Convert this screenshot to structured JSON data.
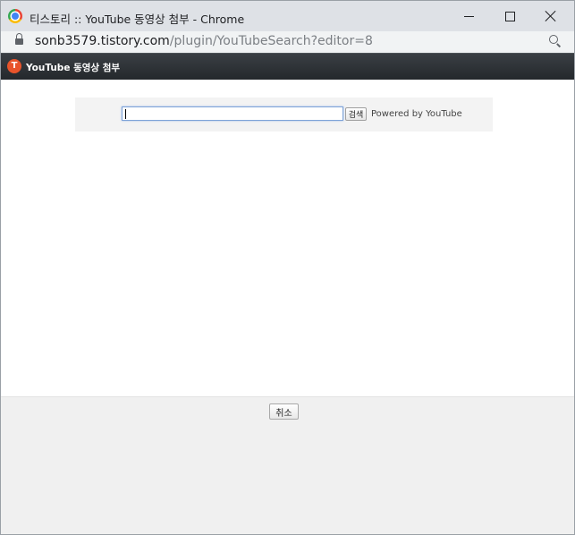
{
  "window": {
    "title": "티스토리 :: YouTube 동영상 첨부 - Chrome"
  },
  "address": {
    "host": "sonb3579.tistory.com",
    "path": "/plugin/YouTubeSearch?editor=8"
  },
  "plugin": {
    "logo_glyph": "T",
    "title": "YouTube 동영상 첨부"
  },
  "search": {
    "value": "",
    "button_label": "검색",
    "powered_by": "Powered by YouTube"
  },
  "footer": {
    "cancel_label": "취소"
  },
  "icons": {
    "browser": "chrome-logo-icon",
    "security": "lock-icon",
    "zoom": "zoom-icon",
    "site": "tistory-logo-icon"
  },
  "colors": {
    "header_bg": "#2b3035",
    "tistory_accent": "#e8542b",
    "input_focus": "#7ea3d8"
  }
}
